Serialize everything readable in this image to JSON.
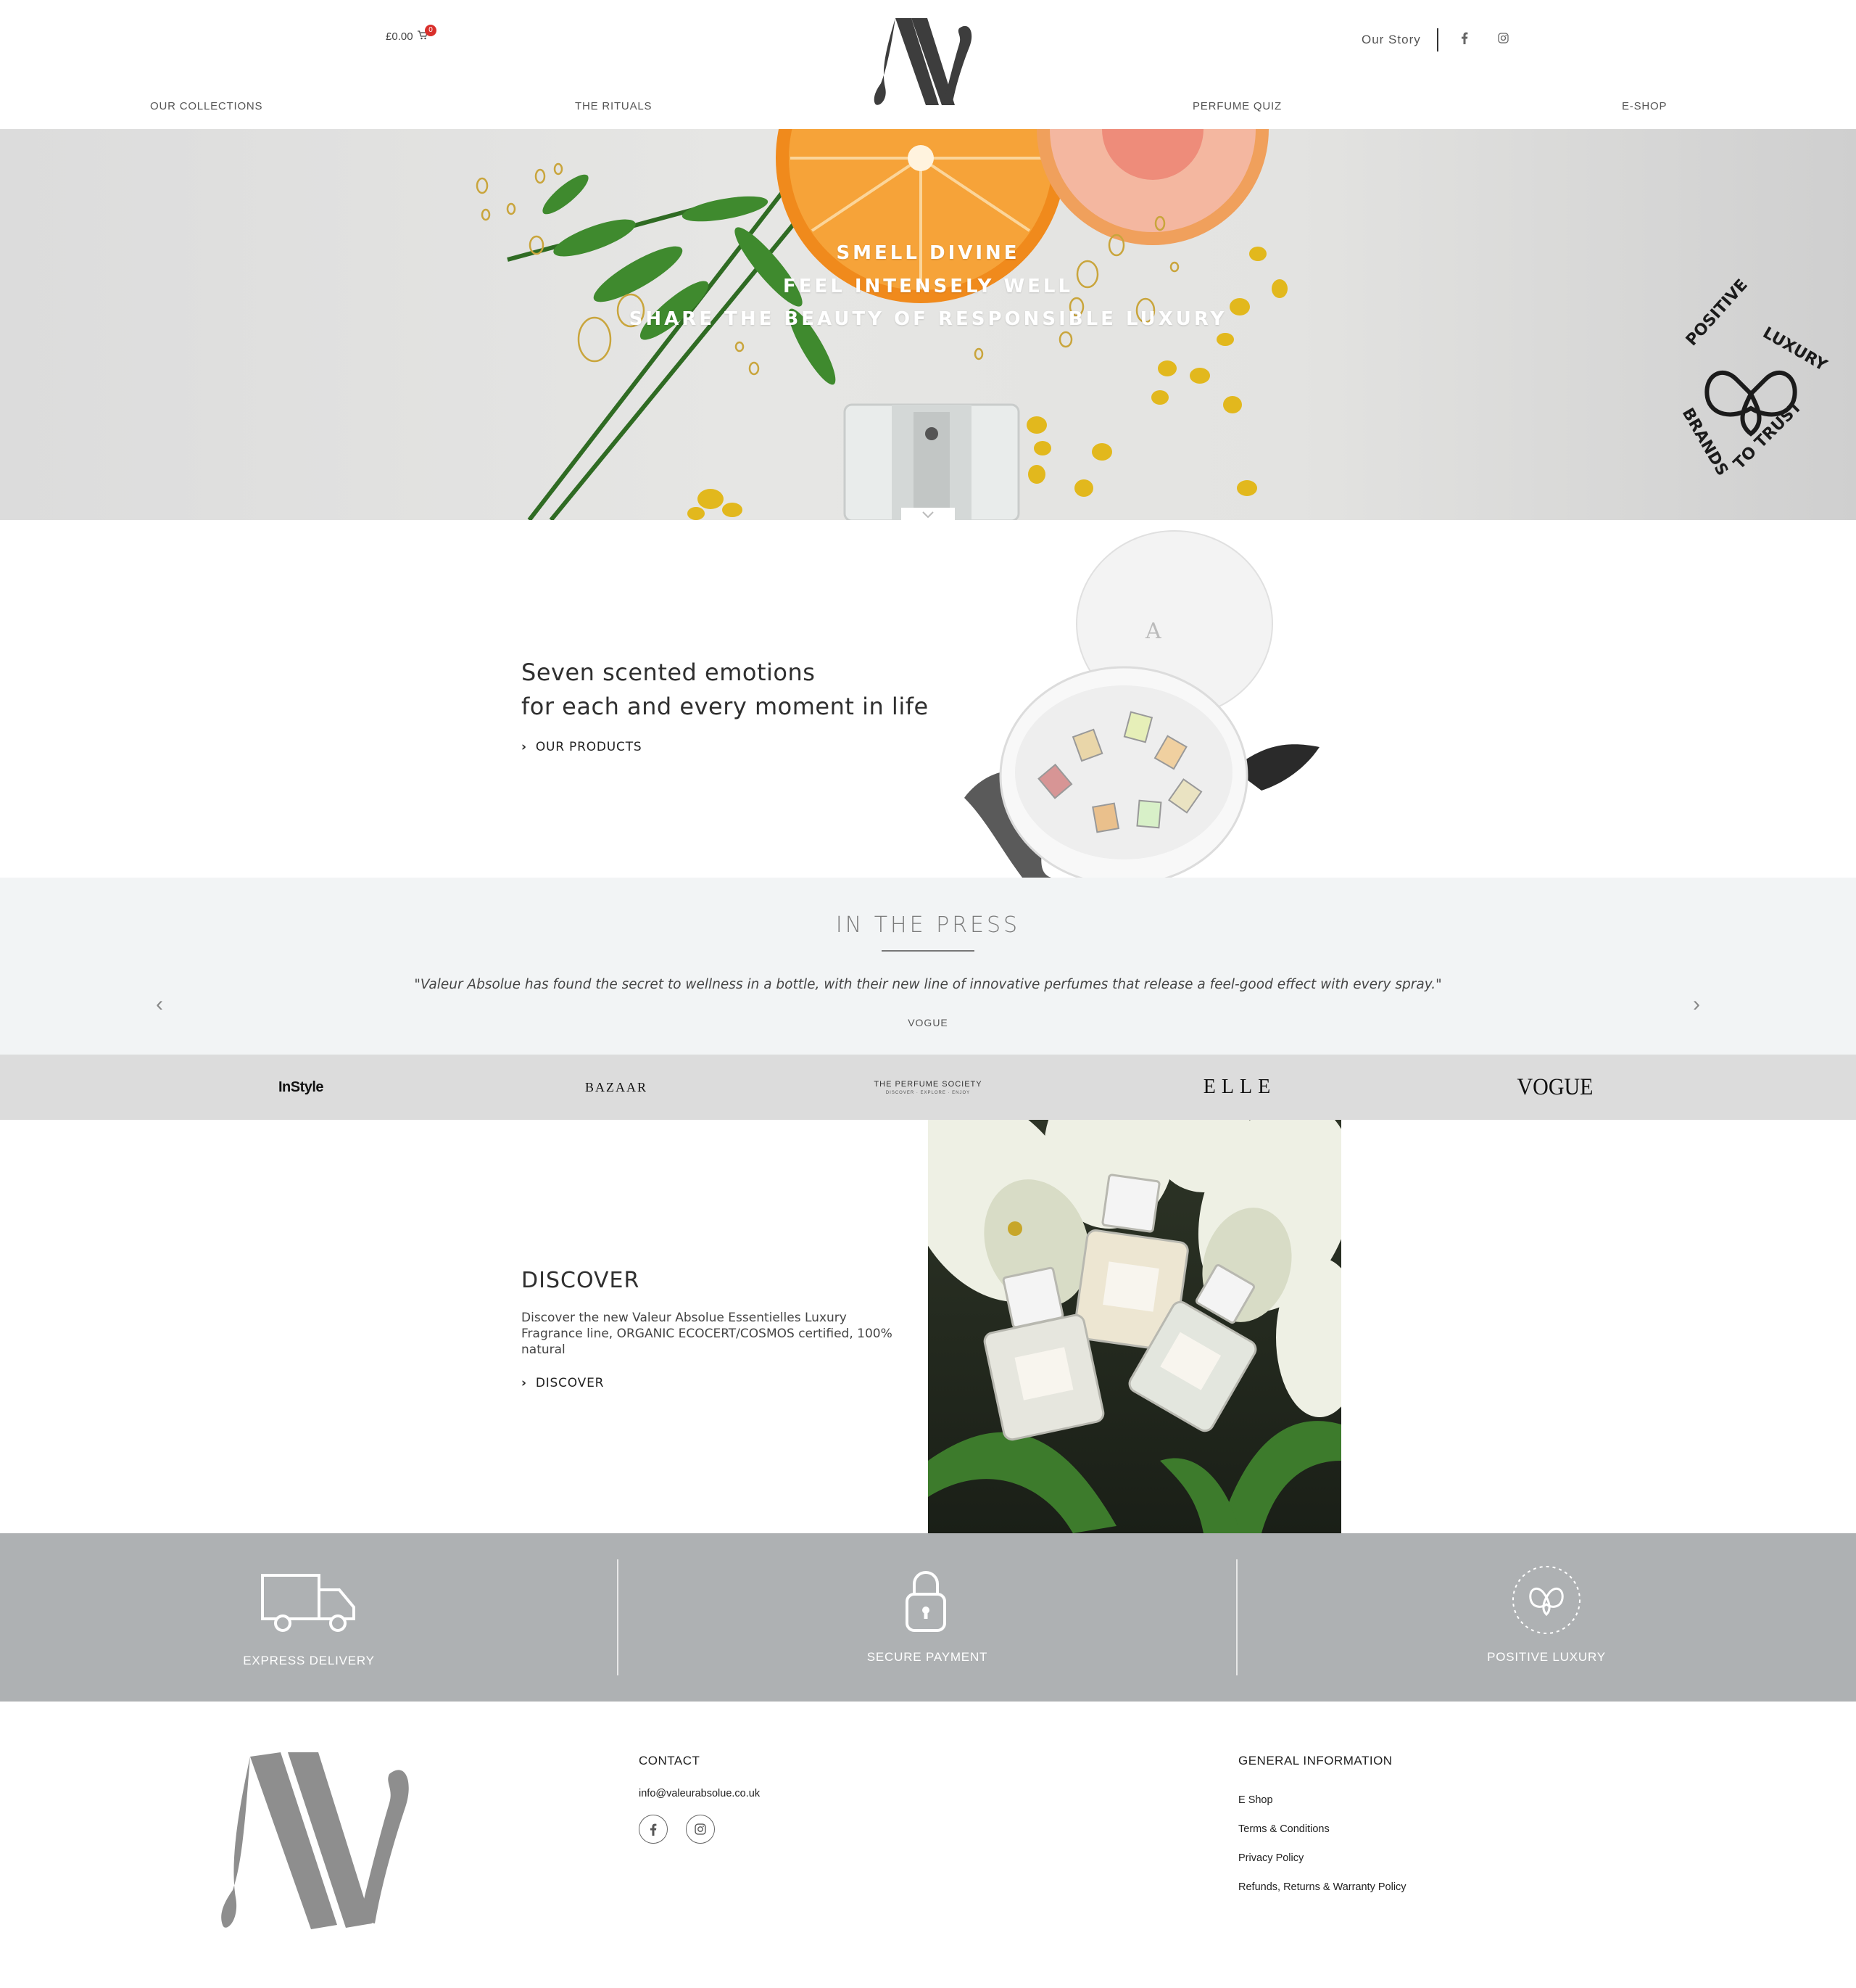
{
  "header": {
    "cart_total": "£0.00",
    "cart_count": "0",
    "our_story": "Our Story",
    "nav": [
      "OUR COLLECTIONS",
      "THE RITUALS",
      "PERFUME QUIZ",
      "E-SHOP"
    ]
  },
  "hero": {
    "line1": "SMELL DIVINE",
    "line2": "FEEL INTENSELY WELL",
    "line3": "SHARE THE BEAUTY OF RESPONSIBLE LUXURY",
    "badge_top": "POSITIVE LUXURY",
    "badge_bottom": "BRANDS TO TRUST"
  },
  "products": {
    "headline_1": "Seven scented emotions",
    "headline_2": "for each and every moment in life",
    "cta": "OUR PRODUCTS"
  },
  "press": {
    "title": "IN THE PRESS",
    "quote": "\"Valeur Absolue has found the secret to wellness in a bottle, with their new line of innovative perfumes that release a feel-good effect with every spray.\"",
    "source": "VOGUE",
    "logos": [
      "InStyle",
      "BAZAAR",
      "THE PERFUME SOCIETY",
      "ELLE",
      "VOGUE"
    ],
    "perfume_society_sub": "DISCOVER · EXPLORE · ENJOY"
  },
  "discover": {
    "title": "DISCOVER",
    "body": "Discover the new Valeur Absolue Essentielles Luxury Fragrance line, ORGANIC ECOCERT/COSMOS certified, 100% natural",
    "cta": "DISCOVER"
  },
  "features": [
    {
      "label": "EXPRESS DELIVERY",
      "icon": "truck-icon"
    },
    {
      "label": "SECURE PAYMENT",
      "icon": "lock-icon"
    },
    {
      "label": "POSITIVE LUXURY",
      "icon": "butterfly-badge-icon"
    }
  ],
  "footer": {
    "contact_heading": "CONTACT",
    "email": "info@valeurabsolue.co.uk",
    "info_heading": "GENERAL INFORMATION",
    "links": [
      "E Shop",
      "Terms & Conditions",
      "Privacy Policy",
      "Refunds, Returns & Warranty Policy"
    ]
  },
  "colors": {
    "features_bg": "#aeb1b3",
    "press_bg": "#f2f4f5",
    "logos_bg": "#dcdcdc",
    "cart_badge": "#d9302c",
    "orange": "#f08a1c"
  }
}
